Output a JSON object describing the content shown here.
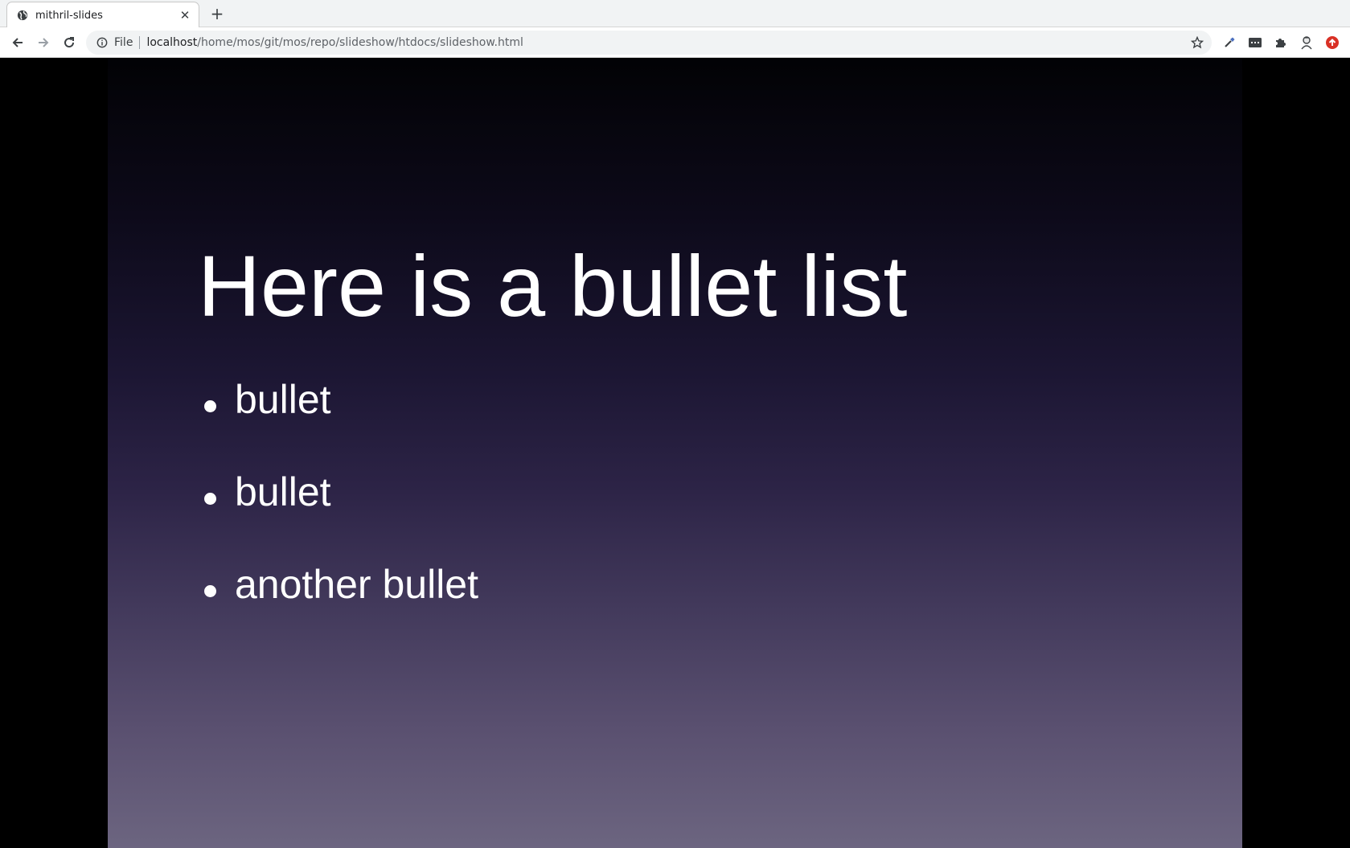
{
  "browser": {
    "tab": {
      "title": "mithril-slides",
      "favicon": "globe-icon",
      "close_icon": "close-icon"
    },
    "new_tab_icon": "plus-icon",
    "toolbar": {
      "back_icon": "back-arrow-icon",
      "forward_icon": "forward-arrow-icon",
      "reload_icon": "reload-icon",
      "address": {
        "info_icon": "info-icon",
        "scheme_label": "File",
        "host": "localhost",
        "path": "/home/mos/git/mos/repo/slideshow/htdocs/slideshow.html",
        "bookmark_icon": "star-icon"
      },
      "extensions": [
        "eyedropper-icon",
        "devtools-icon",
        "puzzle-icon",
        "profile-icon",
        "update-icon"
      ]
    }
  },
  "slide": {
    "title": "Here is a bullet list",
    "bullets": [
      "bullet",
      "bullet",
      "another bullet"
    ],
    "colors": {
      "gradient_top": "#020205",
      "gradient_bottom": "#6c6580",
      "text": "#ffffff"
    }
  }
}
